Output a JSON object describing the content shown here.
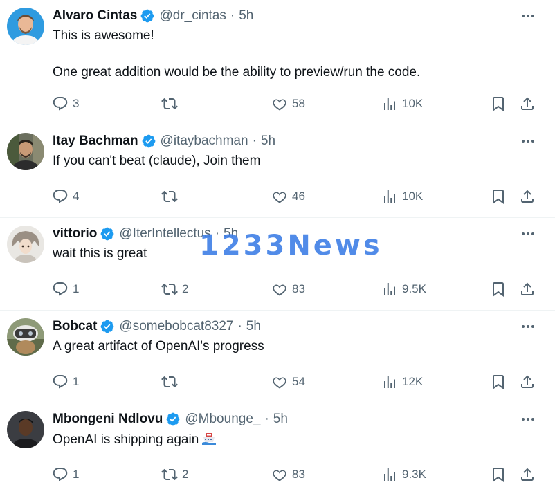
{
  "watermark": "1233News",
  "tweets": [
    {
      "name": "Alvaro Cintas",
      "handle": "@dr_cintas",
      "dot": "·",
      "time": "5h",
      "text": "This is awesome!",
      "text_extra": "One great addition would be the ability to preview/run the code.",
      "replies": "3",
      "retweets": "",
      "likes": "58",
      "views": "10K"
    },
    {
      "name": "Itay Bachman",
      "handle": "@itaybachman",
      "dot": "·",
      "time": "5h",
      "text": "If you can't beat (claude), Join them",
      "replies": "4",
      "retweets": "",
      "likes": "46",
      "views": "10K"
    },
    {
      "name": "vittorio",
      "handle": "@IterIntellectus",
      "dot": "·",
      "time": "5h",
      "text": "wait this is great",
      "replies": "1",
      "retweets": "2",
      "likes": "83",
      "views": "9.5K"
    },
    {
      "name": "Bobcat",
      "handle": "@somebobcat8327",
      "dot": "·",
      "time": "5h",
      "text": "A great artifact of OpenAI's progress",
      "replies": "1",
      "retweets": "",
      "likes": "54",
      "views": "12K"
    },
    {
      "name": "Mbongeni Ndlovu",
      "handle": "@Mbounge_",
      "dot": "·",
      "time": "5h",
      "text": "OpenAI is shipping again",
      "emoji": "ship-emoji",
      "replies": "1",
      "retweets": "2",
      "likes": "83",
      "views": "9.3K"
    }
  ],
  "colors": {
    "verified": "#1d9bf0",
    "secondary_text": "#536471",
    "primary_text": "#0f1419",
    "divider": "#eff3f4",
    "watermark": "#3f7fe6"
  },
  "icons": {
    "reply": "reply-icon",
    "retweet": "retweet-icon",
    "like": "heart-icon",
    "views": "views-icon",
    "bookmark": "bookmark-icon",
    "share": "share-icon",
    "more": "more-icon",
    "verified": "verified-badge-icon"
  }
}
